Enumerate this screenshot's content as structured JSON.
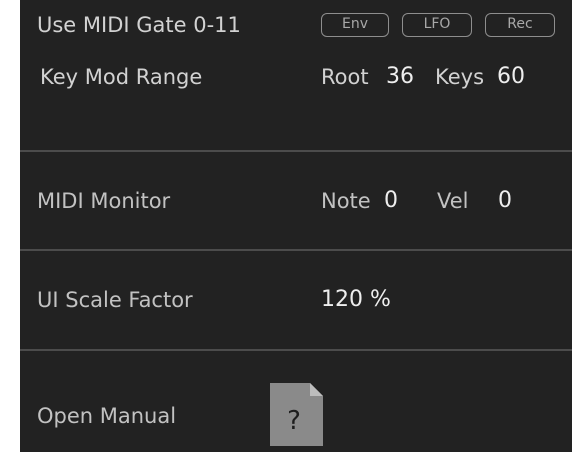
{
  "gate": {
    "label": "Use MIDI Gate 0-11",
    "buttons": [
      "Env",
      "LFO",
      "Rec"
    ]
  },
  "key_mod": {
    "label": "Key Mod Range",
    "root_label": "Root",
    "root_value": "36",
    "keys_label": "Keys",
    "keys_value": "60"
  },
  "monitor": {
    "label": "MIDI Monitor",
    "note_label": "Note",
    "note_value": "0",
    "vel_label": "Vel",
    "vel_value": "0"
  },
  "scale": {
    "label": "UI Scale Factor",
    "value": "120 %"
  },
  "manual": {
    "label": "Open Manual",
    "icon_glyph": "?",
    "icon": "document-help-icon"
  },
  "colors": {
    "background": "#222222",
    "divider": "#4c4c4c",
    "text": "#d2d2d2",
    "button_border": "#8e8e8e",
    "icon_fill": "#8a8a8a"
  }
}
